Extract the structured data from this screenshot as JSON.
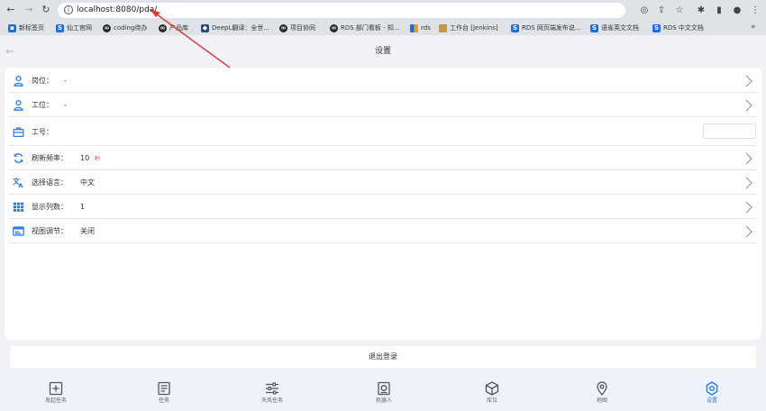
{
  "browser": {
    "url": "localhost:8080/pda/",
    "bookmarks": [
      {
        "label": "新标签页",
        "fav": "blue",
        "glyph": "▪"
      },
      {
        "label": "仙工官网",
        "fav": "blue",
        "glyph": "S"
      },
      {
        "label": "coding待办",
        "fav": "dark",
        "glyph": "∞"
      },
      {
        "label": "产品库",
        "fav": "dark",
        "glyph": "∞"
      },
      {
        "label": "DeepL翻译：全世...",
        "fav": "navy",
        "glyph": "◆"
      },
      {
        "label": "项目协同",
        "fav": "dark",
        "glyph": "∞"
      },
      {
        "label": "RDS 部门看板 - 知...",
        "fav": "dark",
        "glyph": "∞"
      },
      {
        "label": "rds",
        "fav": "win",
        "glyph": ""
      },
      {
        "label": "工作台 [Jenkins]",
        "fav": "gold",
        "glyph": ""
      },
      {
        "label": "RDS 网页端发布说...",
        "fav": "blue",
        "glyph": "S"
      },
      {
        "label": "语雀英文文档",
        "fav": "blue",
        "glyph": "S"
      },
      {
        "label": "RDS 中文文档",
        "fav": "blue",
        "glyph": "S"
      }
    ],
    "more": "»"
  },
  "header": {
    "title": "设置"
  },
  "settings": {
    "post": {
      "label": "岗位：",
      "value": "-"
    },
    "station": {
      "label": "工位：",
      "value": "-"
    },
    "employee_id": {
      "label": "工号：",
      "value": ""
    },
    "refresh": {
      "label": "刷新频率：",
      "value": "10",
      "unit": "秒"
    },
    "language": {
      "label": "选择语言：",
      "value": "中文"
    },
    "columns": {
      "label": "显示列数：",
      "value": "1"
    },
    "view_adjust": {
      "label": "视图调节：",
      "value": "关闭"
    }
  },
  "logout_label": "退出登录",
  "tabs": [
    {
      "label": "发起任务",
      "icon": "plus-square-icon",
      "active": false
    },
    {
      "label": "任务",
      "icon": "document-icon",
      "active": false
    },
    {
      "label": "天风任务",
      "icon": "sliders-icon",
      "active": false
    },
    {
      "label": "机器人",
      "icon": "robot-icon",
      "active": false
    },
    {
      "label": "库位",
      "icon": "cube-icon",
      "active": false
    },
    {
      "label": "地图",
      "icon": "map-pin-icon",
      "active": false
    },
    {
      "label": "设置",
      "icon": "gear-icon",
      "active": true
    }
  ],
  "colors": {
    "accent": "#2b7bea",
    "unit_red": "#e0473a",
    "annotation": "#e53935"
  }
}
